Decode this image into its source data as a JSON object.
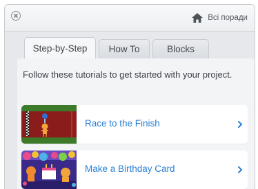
{
  "header": {
    "all_tips_label": "Всі поради",
    "home_icon": "home-icon",
    "close_icon": "close-icon"
  },
  "tabs": [
    {
      "label": "Step-by-Step",
      "active": true
    },
    {
      "label": "How To",
      "active": false
    },
    {
      "label": "Blocks",
      "active": false
    }
  ],
  "intro": "Follow these tutorials to get started with your project.",
  "tutorials": [
    {
      "title": "Race to the Finish",
      "icon": "chevron-right-icon"
    },
    {
      "title": "Make a Birthday Card",
      "icon": "chevron-right-icon"
    }
  ],
  "colors": {
    "link": "#2a7fd4",
    "accent_orange": "#f0a43a"
  }
}
